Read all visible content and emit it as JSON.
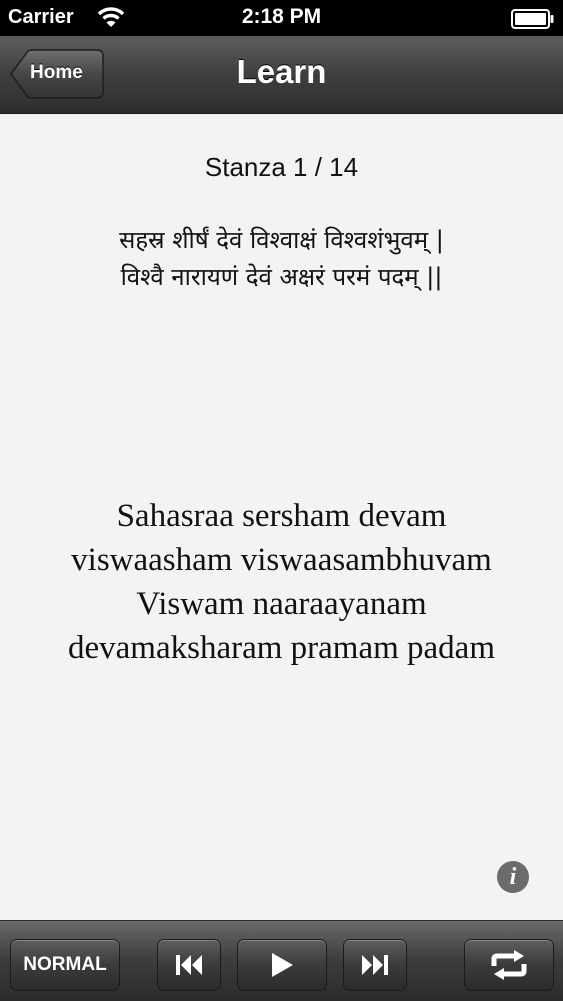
{
  "status_bar": {
    "carrier": "Carrier",
    "time": "2:18 PM",
    "wifi_icon": "wifi-icon",
    "battery_icon": "battery-icon"
  },
  "nav": {
    "back_label": "Home",
    "title": "Learn"
  },
  "content": {
    "stanza_label": "Stanza 1 / 14",
    "sanskrit_lines": [
      "सहस्र शीर्षं देवं विश्वाक्षं विश्वशंभुवम् |",
      "विश्वै नारायणं देवं अक्षरं परमं पदम् ||"
    ],
    "transliteration_lines": [
      "Sahasraa sersham devam",
      "viswaasham viswaasambhuvam",
      "Viswam naaraayanam",
      "devamaksharam pramam padam"
    ],
    "info_icon": "info-icon"
  },
  "toolbar": {
    "mode_label": "NORMAL",
    "prev_icon": "skip-back-icon",
    "play_icon": "play-icon",
    "next_icon": "skip-forward-icon",
    "repeat_icon": "repeat-icon"
  }
}
